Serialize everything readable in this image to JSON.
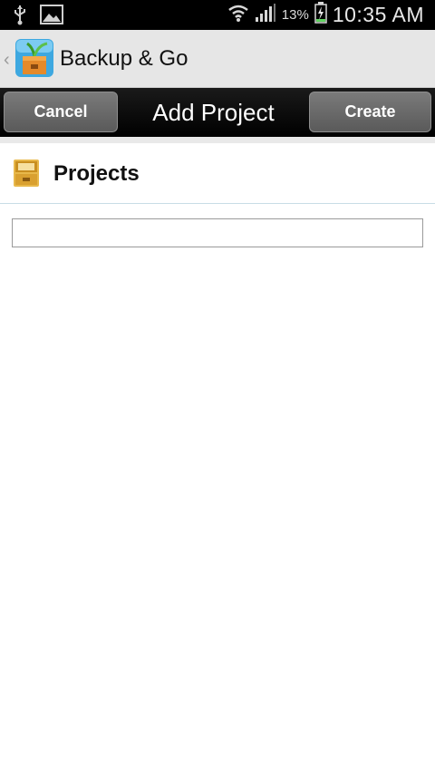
{
  "status_bar": {
    "battery_percent": "13%",
    "time": "10:35 AM"
  },
  "app_bar": {
    "title": "Backup & Go"
  },
  "toolbar": {
    "cancel_label": "Cancel",
    "title": "Add Project",
    "create_label": "Create"
  },
  "section": {
    "title": "Projects"
  },
  "project_name_input": {
    "value": "",
    "placeholder": ""
  }
}
